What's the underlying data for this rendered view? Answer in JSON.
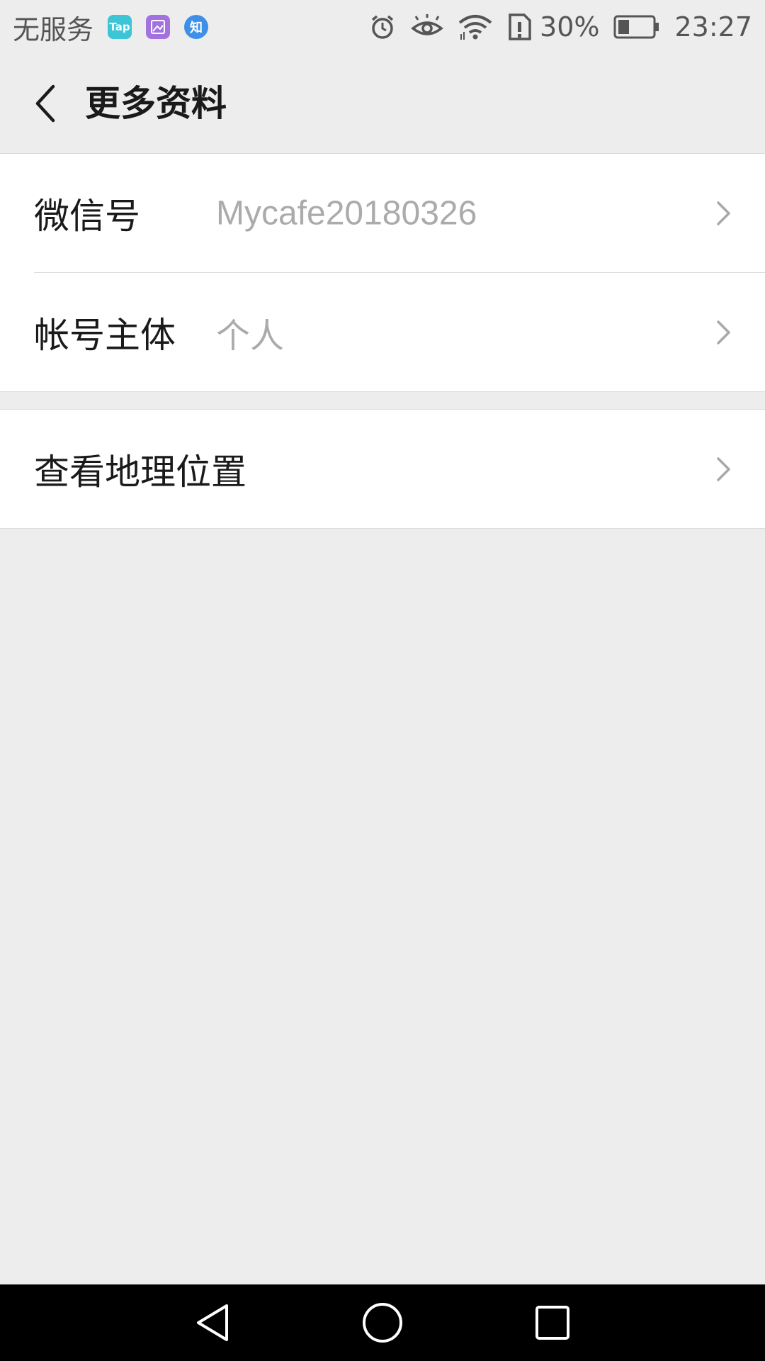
{
  "status_bar": {
    "carrier": "无服务",
    "app_icons": [
      {
        "name": "tap-icon",
        "text": "Tap"
      },
      {
        "name": "gallery-icon",
        "text": ""
      },
      {
        "name": "zhihu-icon",
        "text": "知"
      }
    ],
    "battery_percent": "30%",
    "time": "23:27"
  },
  "header": {
    "title": "更多资料"
  },
  "rows": {
    "wechat_id": {
      "label": "微信号",
      "value": "Mycafe20180326"
    },
    "account_subject": {
      "label": "帐号主体",
      "value": "个人"
    },
    "location": {
      "label": "查看地理位置"
    }
  },
  "colors": {
    "background": "#ededed",
    "card": "#ffffff",
    "label": "#1a1a1a",
    "value": "#ababab"
  }
}
